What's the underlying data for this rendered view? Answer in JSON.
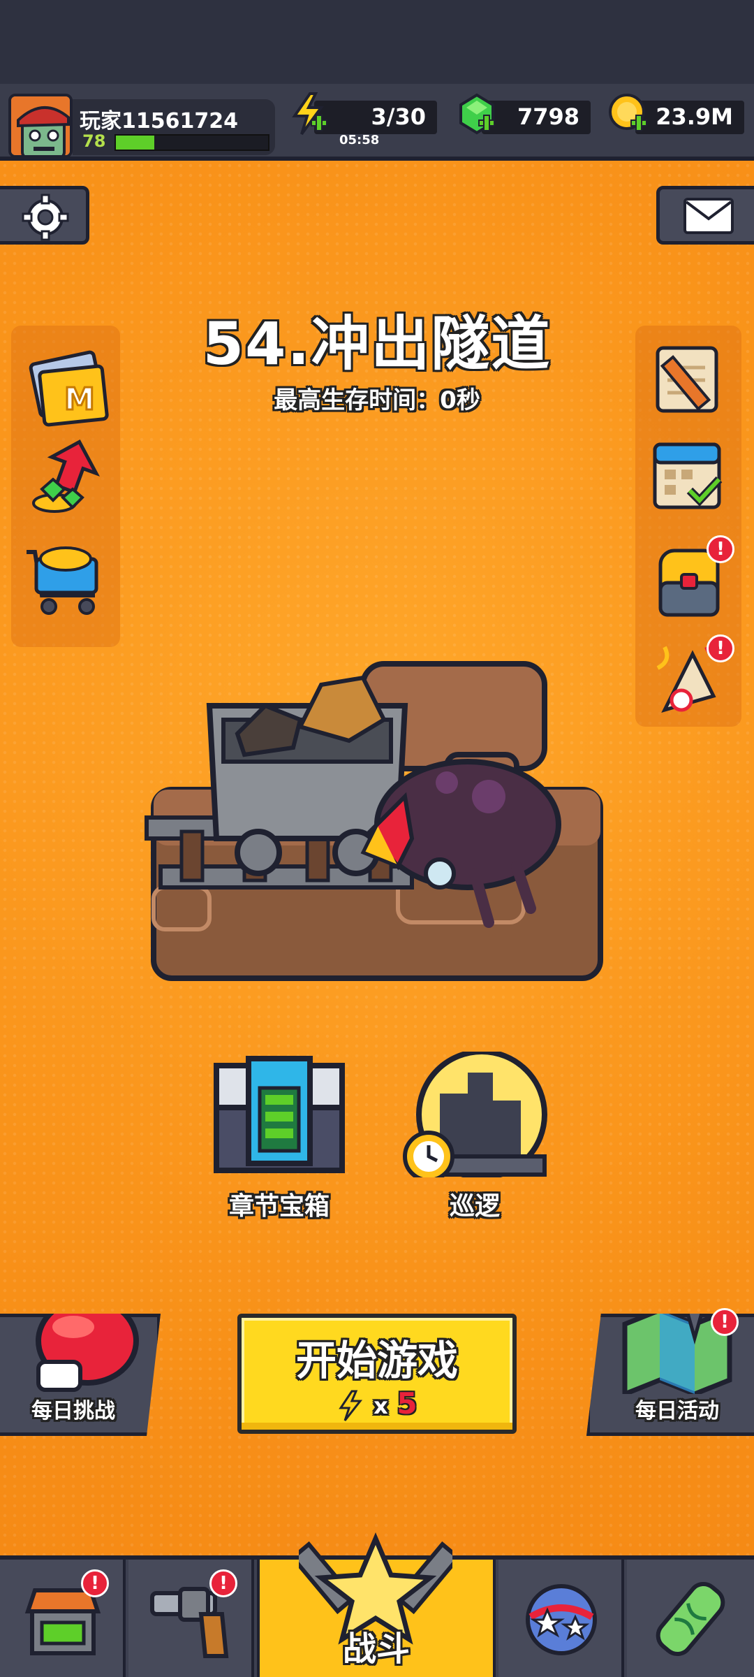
{
  "player": {
    "name": "玩家11561724",
    "level": "78",
    "xp_fraction": 0.25
  },
  "resources": {
    "energy": {
      "value": "3/30",
      "timer": "05:58",
      "icon": "lightning-plus-icon"
    },
    "gems": {
      "value": "7798",
      "icon": "green-gem-plus-icon"
    },
    "coins": {
      "value": "23.9M",
      "icon": "gold-coin-plus-icon"
    }
  },
  "stage": {
    "title": "54.冲出隧道",
    "subtitle": "最高生存时间：0秒"
  },
  "left_panel": [
    {
      "name": "monthly-card-icon",
      "letter": "M"
    },
    {
      "name": "growth-fund-icon"
    },
    {
      "name": "shop-cart-icon"
    }
  ],
  "right_panel": [
    {
      "name": "quest-scroll-icon",
      "badge": false
    },
    {
      "name": "calendar-check-icon",
      "badge": false
    },
    {
      "name": "backpack-icon",
      "badge": true
    },
    {
      "name": "party-popper-icon",
      "badge": true
    }
  ],
  "badge_mark": "!",
  "actions": {
    "chapter_chest": "章节宝箱",
    "patrol": "巡逻",
    "daily_challenge": "每日挑战",
    "daily_event": "每日活动",
    "start_game": "开始游戏",
    "start_cost_prefix": "x",
    "start_cost": "5"
  },
  "nav": {
    "battle": "战斗",
    "items": [
      "shop-stall-icon",
      "revolver-icon",
      "battle-star-icon",
      "talent-orb-icon",
      "dna-capsule-icon"
    ]
  },
  "colors": {
    "background_orange": "#f9931a",
    "start_button_yellow": "#ffd91f",
    "xp_green": "#5ecf29",
    "badge_red": "#e8233a"
  }
}
